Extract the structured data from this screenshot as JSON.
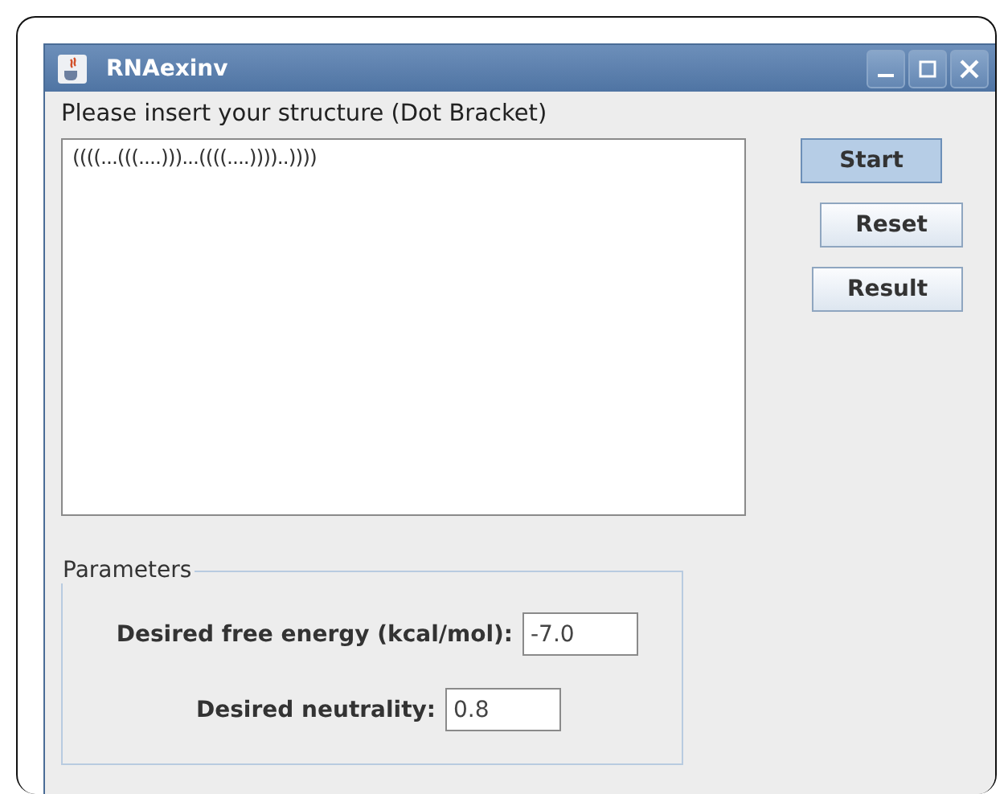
{
  "window": {
    "title": "RNAexinv"
  },
  "prompt": "Please insert your structure (Dot Bracket)",
  "structure": {
    "value": "((((...(((....)))...((((....))))..))))"
  },
  "buttons": [
    {
      "label": "Start",
      "selected": true
    },
    {
      "label": "Reset",
      "selected": false
    },
    {
      "label": "Result",
      "selected": false
    }
  ],
  "parameters": {
    "title": "Parameters",
    "fields": [
      {
        "label": "Desired free energy (kcal/mol):",
        "value": "-7.0"
      },
      {
        "label": "Desired neutrality:",
        "value": "0.8"
      }
    ]
  }
}
